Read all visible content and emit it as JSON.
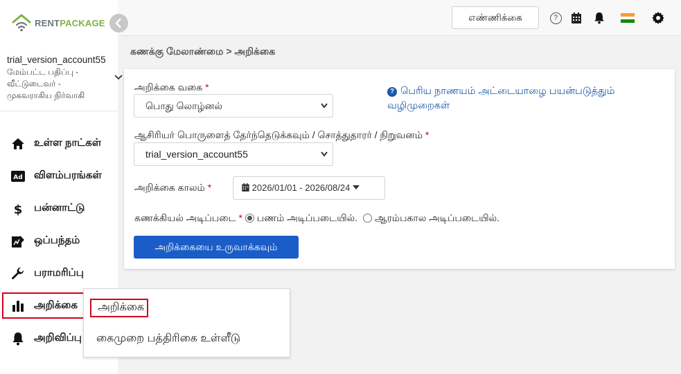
{
  "logo": {
    "part1": "RENT",
    "part2": "PACKAGE"
  },
  "account": {
    "name": "trial_version_account55",
    "line2": "மேம்பட்ட பதிப்பு -",
    "line3": "வீட்டுடைவர் -",
    "line4": "முகவராகிய நிர்வாகி"
  },
  "nav": [
    {
      "label": "உள்ள நாட்கள்",
      "icon": "home-icon"
    },
    {
      "label": "விளம்பரங்கள்",
      "icon": "ad-icon"
    },
    {
      "label": "பன்னாட்டு",
      "icon": "dollar-icon"
    },
    {
      "label": "ஒப்பந்தம்",
      "icon": "contract-icon"
    },
    {
      "label": "பராமரிப்பு",
      "icon": "wrench-icon"
    },
    {
      "label": "அறிக்கை",
      "icon": "bar-chart-icon"
    },
    {
      "label": "அறிவிப்பு",
      "icon": "bell-icon"
    }
  ],
  "topbar": {
    "count_button": "எண்ணிக்கை",
    "help_glyph": "?"
  },
  "breadcrumb": "கணக்கு மேலாண்மை > அறிக்கை",
  "form": {
    "report_type_label": "அறிக்கை வகை",
    "report_type_value": "பொது லொழ்னல்",
    "owner_label": "ஆசிரியர் பொருளைத் தேர்ந்தெடுக்கவும் / சொத்துதாரர் / நிறுவனம்",
    "owner_value": "trial_version_account55",
    "period_label": "அறிக்கை காலம்",
    "period_value": "2026/01/01 - 2026/08/24",
    "basis_label": "கணக்கியல் அடிப்படை",
    "basis_option1": "பணம் அடிப்படையில்.",
    "basis_option2": "ஆரம்பகால அடிப்படையில்.",
    "required_mark": "*",
    "generate_button": "அறிக்கையை உருவாக்கவும்"
  },
  "help_link": "பெரிய நாணயம் அட்டையாழை பயன்படுத்தும் வழிமுறைகள்",
  "dropdown": {
    "items": [
      "அறிக்கை",
      "கைமுறை பத்திரிகை உள்ளீடு"
    ]
  },
  "colors": {
    "accent": "#1a5dc8",
    "highlight": "#d0021b",
    "brand_green": "#7cb342"
  }
}
